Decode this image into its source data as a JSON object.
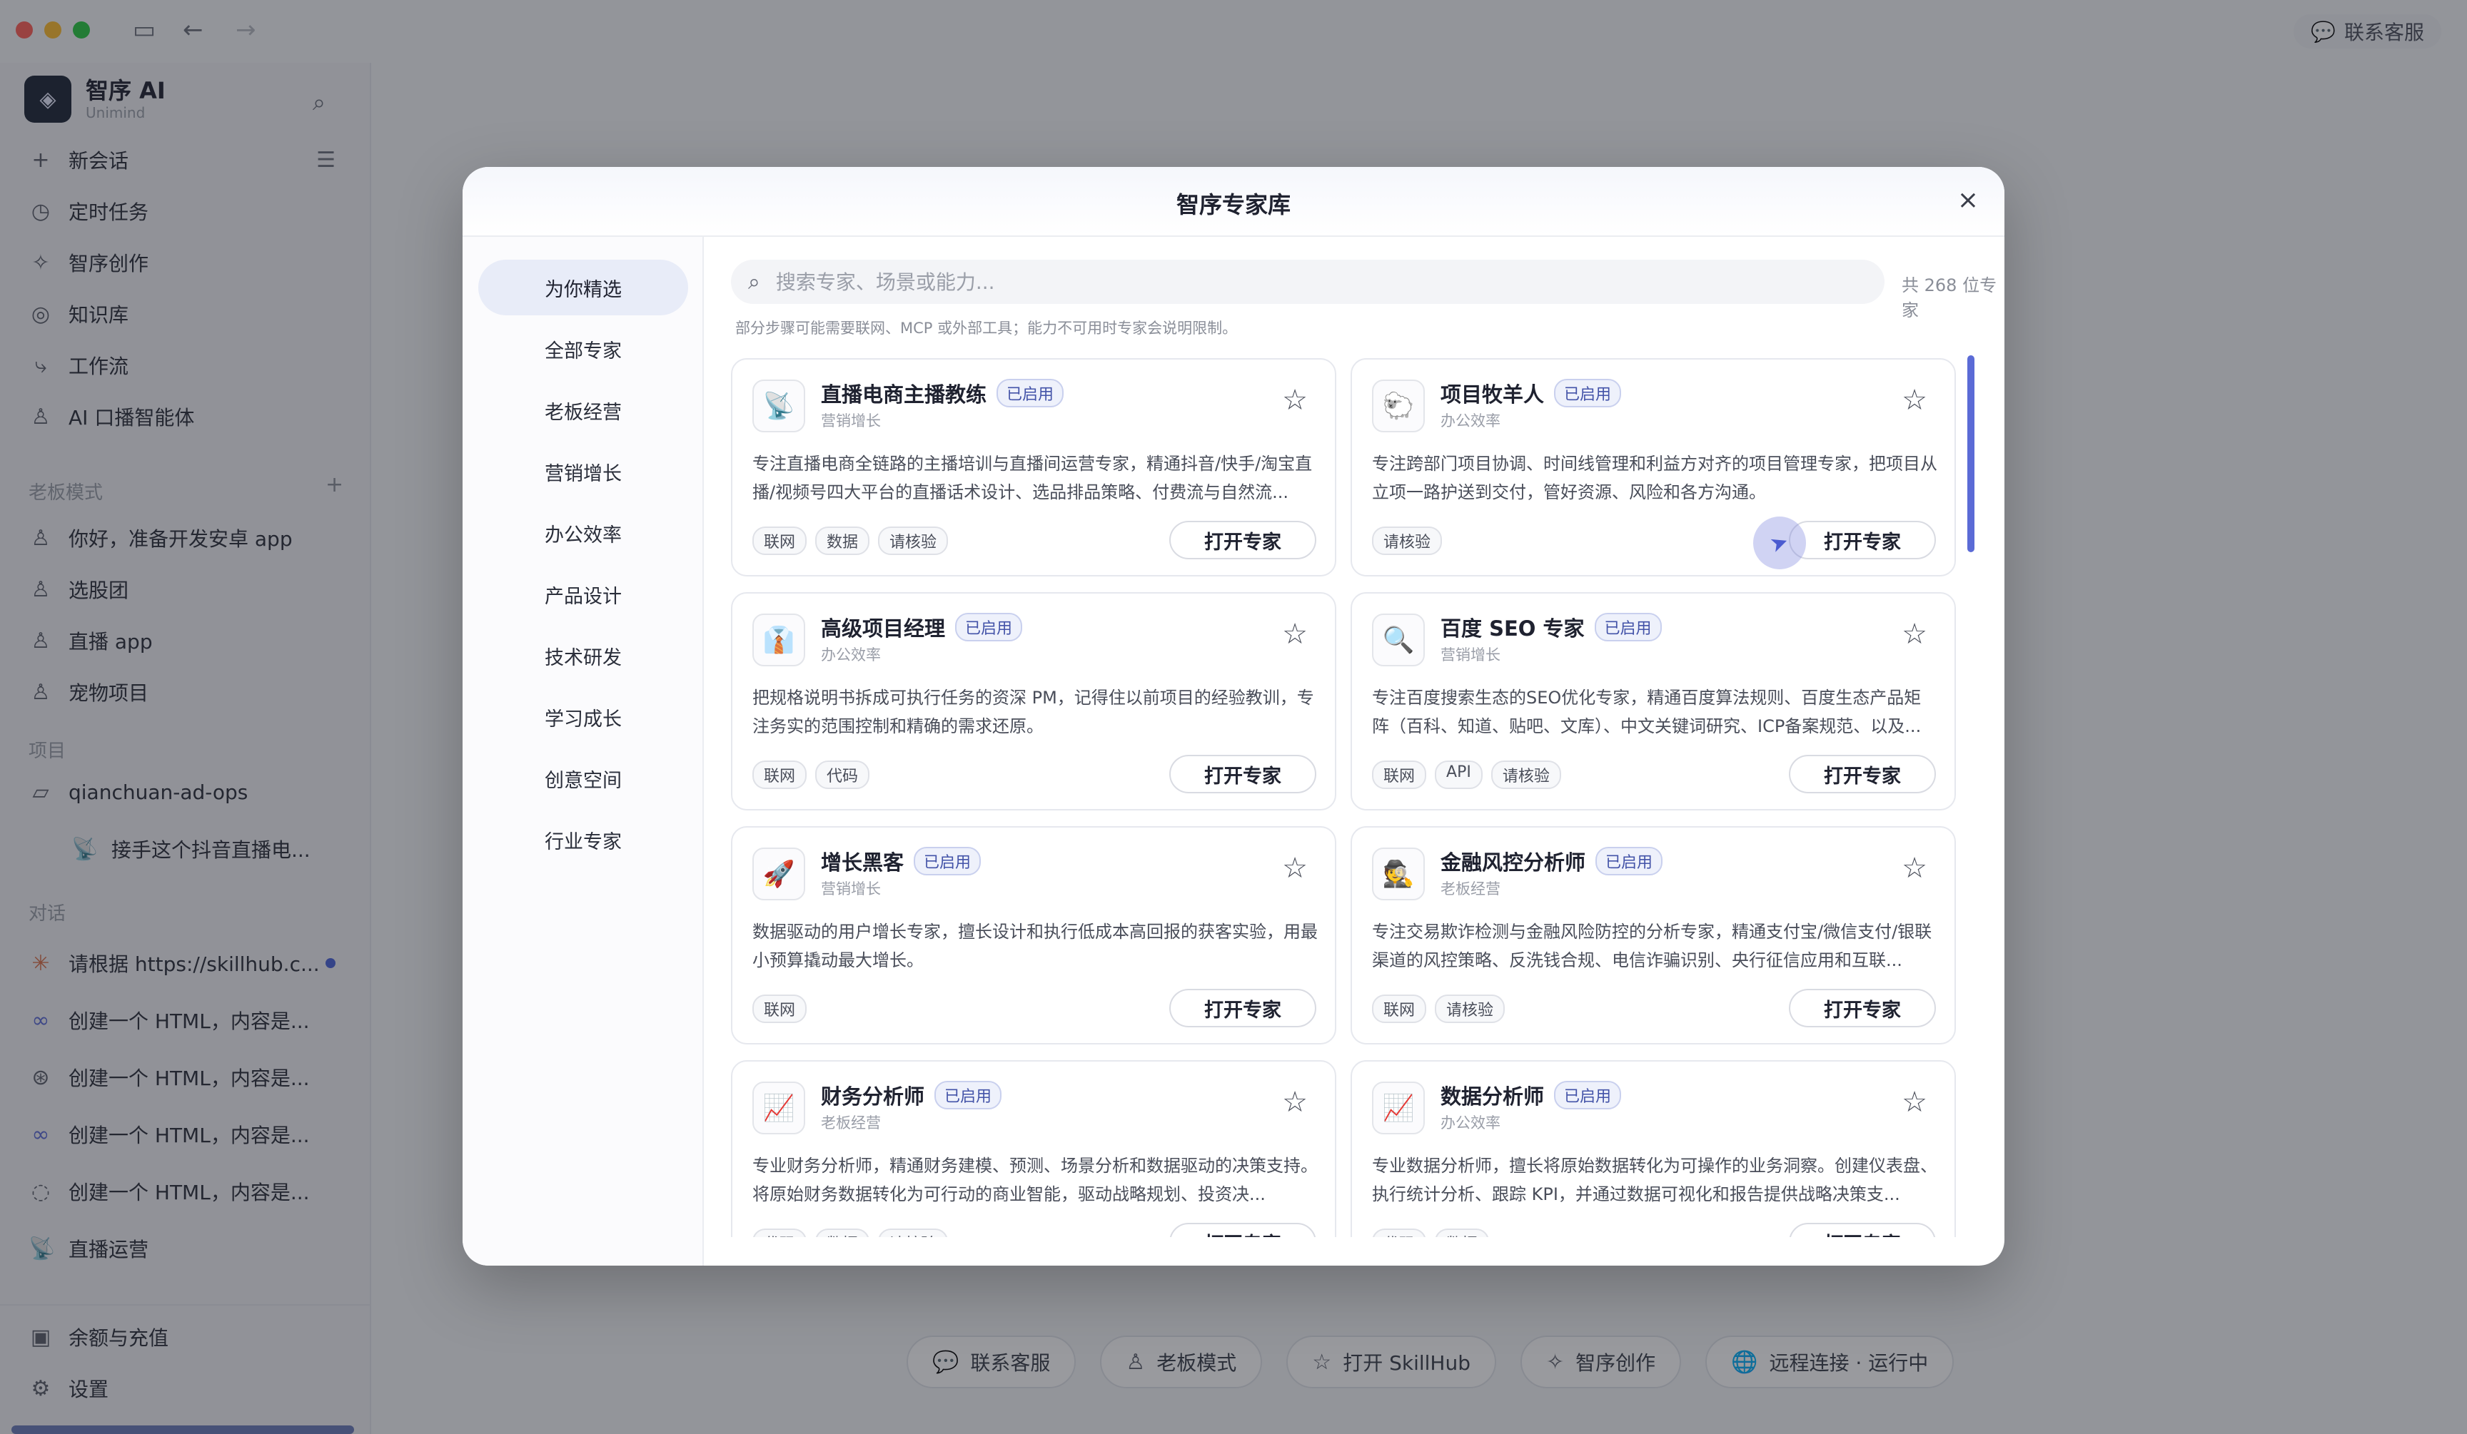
{
  "titlebar": {
    "support_label": "联系客服"
  },
  "sidebar": {
    "brand_name": "智序 AI",
    "brand_sub": "Unimind",
    "new_chat": "新会话",
    "nav": [
      {
        "label": "定时任务",
        "icon": "clock-icon"
      },
      {
        "label": "智序创作",
        "icon": "sparkle-icon"
      },
      {
        "label": "知识库",
        "icon": "knowledge-icon"
      },
      {
        "label": "工作流",
        "icon": "workflow-icon"
      },
      {
        "label": "AI 口播智能体",
        "icon": "user-icon"
      }
    ],
    "boss_section": "老板模式",
    "boss_items": [
      "你好，准备开发安卓 app",
      "选股团",
      "直播 app",
      "宠物项目"
    ],
    "project_section": "项目",
    "project_folder": "qianchuan-ad-ops",
    "project_child": "接手这个抖音直播电...",
    "chat_section": "对话",
    "chats": [
      "请根据 https://skillhub.c...",
      "创建一个 HTML，内容是...",
      "创建一个 HTML，内容是...",
      "创建一个 HTML，内容是...",
      "创建一个 HTML，内容是...",
      "直播运营"
    ],
    "balance": "余额与充值",
    "settings": "设置"
  },
  "bottom_bar": {
    "support": "联系客服",
    "boss_mode": "老板模式",
    "skillhub": "打开 SkillHub",
    "creation": "智序创作",
    "remote": "远程连接 · 运行中"
  },
  "modal": {
    "title": "智序专家库",
    "categories": [
      "为你精选",
      "全部专家",
      "老板经营",
      "营销增长",
      "办公效率",
      "产品设计",
      "技术研发",
      "学习成长",
      "创意空间",
      "行业专家"
    ],
    "search_placeholder": "搜索专家、场景或能力...",
    "total": "共 268 位专家",
    "note": "部分步骤可能需要联网、MCP 或外部工具；能力不可用时专家会说明限制。",
    "open_label": "打开专家",
    "cards": [
      {
        "title": "直播电商主播教练",
        "badge": "已启用",
        "category": "营销增长",
        "icon": "📡",
        "desc": "专注直播电商全链路的主播培训与直播间运营专家，精通抖音/快手/淘宝直播/视频号四大平台的直播话术设计、选品排品策略、付费流与自然流...",
        "tags": [
          "联网",
          "数据",
          "请核验"
        ]
      },
      {
        "title": "项目牧羊人",
        "badge": "已启用",
        "category": "办公效率",
        "icon": "🐑",
        "desc": "专注跨部门项目协调、时间线管理和利益方对齐的项目管理专家，把项目从立项一路护送到交付，管好资源、风险和各方沟通。",
        "tags": [
          "请核验"
        ]
      },
      {
        "title": "高级项目经理",
        "badge": "已启用",
        "category": "办公效率",
        "icon": "👔",
        "desc": "把规格说明书拆成可执行任务的资深 PM，记得住以前项目的经验教训，专注务实的范围控制和精确的需求还原。",
        "tags": [
          "联网",
          "代码"
        ]
      },
      {
        "title": "百度 SEO 专家",
        "badge": "已启用",
        "category": "营销增长",
        "icon": "🔍",
        "desc": "专注百度搜索生态的SEO优化专家，精通百度算法规则、百度生态产品矩阵（百科、知道、贴吧、文库）、中文关键词研究、ICP备案规范、以及...",
        "tags": [
          "联网",
          "API",
          "请核验"
        ]
      },
      {
        "title": "增长黑客",
        "badge": "已启用",
        "category": "营销增长",
        "icon": "🚀",
        "desc": "数据驱动的用户增长专家，擅长设计和执行低成本高回报的获客实验，用最小预算撬动最大增长。",
        "tags": [
          "联网"
        ]
      },
      {
        "title": "金融风控分析师",
        "badge": "已启用",
        "category": "老板经营",
        "icon": "🕵",
        "desc": "专注交易欺诈检测与金融风险防控的分析专家，精通支付宝/微信支付/银联渠道的风控策略、反洗钱合规、电信诈骗识别、央行征信应用和互联...",
        "tags": [
          "联网",
          "请核验"
        ]
      },
      {
        "title": "财务分析师",
        "badge": "已启用",
        "category": "老板经营",
        "icon": "📈",
        "desc": "专业财务分析师，精通财务建模、预测、场景分析和数据驱动的决策支持。将原始财务数据转化为可行动的商业智能，驱动战略规划、投资决...",
        "tags": [
          "代码",
          "数据",
          "请核验"
        ]
      },
      {
        "title": "数据分析师",
        "badge": "已启用",
        "category": "办公效率",
        "icon": "📈",
        "desc": "专业数据分析师，擅长将原始数据转化为可操作的业务洞察。创建仪表盘、执行统计分析、跟踪 KPI，并通过数据可视化和报告提供战略决策支...",
        "tags": [
          "代码",
          "数据"
        ]
      }
    ]
  }
}
